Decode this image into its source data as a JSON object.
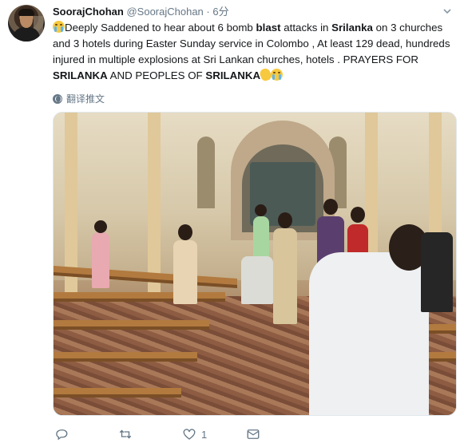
{
  "author": {
    "name": "SoorajChohan",
    "handle": "@SoorajChohan",
    "separator": "·",
    "time": "6分"
  },
  "tweet": {
    "seg1": "Deeply Saddened to hear about 6 bomb ",
    "bold1": "blast",
    "seg2": " attacks in ",
    "bold2": "Srilanka",
    "seg3": " on 3 churches and 3 hotels  during Easter Sunday service in Colombo  , At least 129 dead, hundreds injured in multiple explosions at Sri Lankan churches, hotels . PRAYERS FOR ",
    "bold3": "SRILANKA",
    "seg4": " AND PEOPLES OF ",
    "bold4": "SRILANKA"
  },
  "translate_label": "翻译推文",
  "actions": {
    "reply_count": "",
    "retweet_count": "",
    "like_count": "1",
    "dm_count": ""
  },
  "icons": [
    "avatar",
    "crying-face-emoji",
    "clapping-hands-emoji",
    "globe-icon",
    "chevron-down-icon",
    "reply-icon",
    "retweet-icon",
    "like-icon",
    "message-icon"
  ],
  "colors": {
    "text": "#14171a",
    "muted": "#657786",
    "border": "#e1e8ed"
  }
}
